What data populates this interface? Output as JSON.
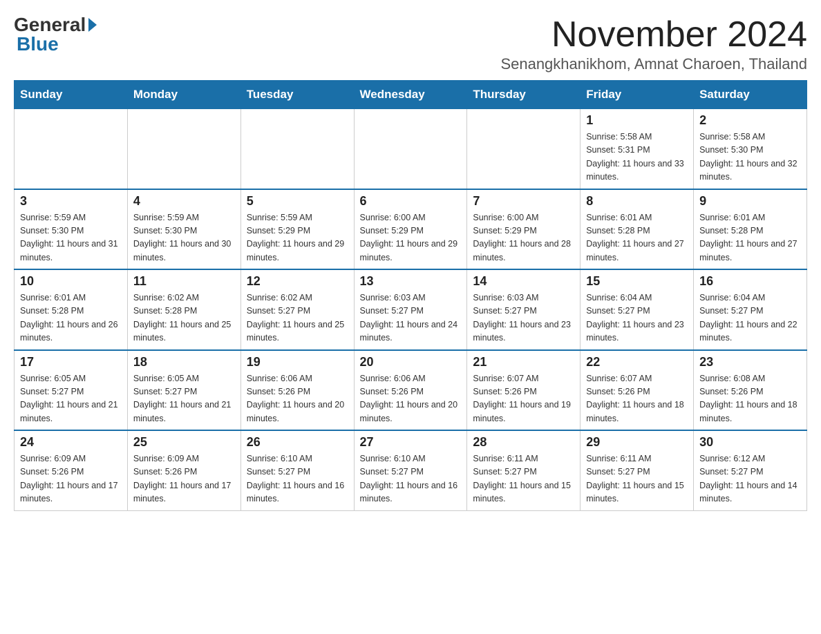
{
  "logo": {
    "general": "General",
    "blue": "Blue"
  },
  "title": "November 2024",
  "subtitle": "Senangkhanikhom, Amnat Charoen, Thailand",
  "days": [
    "Sunday",
    "Monday",
    "Tuesday",
    "Wednesday",
    "Thursday",
    "Friday",
    "Saturday"
  ],
  "weeks": [
    [
      {
        "day": "",
        "info": ""
      },
      {
        "day": "",
        "info": ""
      },
      {
        "day": "",
        "info": ""
      },
      {
        "day": "",
        "info": ""
      },
      {
        "day": "",
        "info": ""
      },
      {
        "day": "1",
        "info": "Sunrise: 5:58 AM\nSunset: 5:31 PM\nDaylight: 11 hours and 33 minutes."
      },
      {
        "day": "2",
        "info": "Sunrise: 5:58 AM\nSunset: 5:30 PM\nDaylight: 11 hours and 32 minutes."
      }
    ],
    [
      {
        "day": "3",
        "info": "Sunrise: 5:59 AM\nSunset: 5:30 PM\nDaylight: 11 hours and 31 minutes."
      },
      {
        "day": "4",
        "info": "Sunrise: 5:59 AM\nSunset: 5:30 PM\nDaylight: 11 hours and 30 minutes."
      },
      {
        "day": "5",
        "info": "Sunrise: 5:59 AM\nSunset: 5:29 PM\nDaylight: 11 hours and 29 minutes."
      },
      {
        "day": "6",
        "info": "Sunrise: 6:00 AM\nSunset: 5:29 PM\nDaylight: 11 hours and 29 minutes."
      },
      {
        "day": "7",
        "info": "Sunrise: 6:00 AM\nSunset: 5:29 PM\nDaylight: 11 hours and 28 minutes."
      },
      {
        "day": "8",
        "info": "Sunrise: 6:01 AM\nSunset: 5:28 PM\nDaylight: 11 hours and 27 minutes."
      },
      {
        "day": "9",
        "info": "Sunrise: 6:01 AM\nSunset: 5:28 PM\nDaylight: 11 hours and 27 minutes."
      }
    ],
    [
      {
        "day": "10",
        "info": "Sunrise: 6:01 AM\nSunset: 5:28 PM\nDaylight: 11 hours and 26 minutes."
      },
      {
        "day": "11",
        "info": "Sunrise: 6:02 AM\nSunset: 5:28 PM\nDaylight: 11 hours and 25 minutes."
      },
      {
        "day": "12",
        "info": "Sunrise: 6:02 AM\nSunset: 5:27 PM\nDaylight: 11 hours and 25 minutes."
      },
      {
        "day": "13",
        "info": "Sunrise: 6:03 AM\nSunset: 5:27 PM\nDaylight: 11 hours and 24 minutes."
      },
      {
        "day": "14",
        "info": "Sunrise: 6:03 AM\nSunset: 5:27 PM\nDaylight: 11 hours and 23 minutes."
      },
      {
        "day": "15",
        "info": "Sunrise: 6:04 AM\nSunset: 5:27 PM\nDaylight: 11 hours and 23 minutes."
      },
      {
        "day": "16",
        "info": "Sunrise: 6:04 AM\nSunset: 5:27 PM\nDaylight: 11 hours and 22 minutes."
      }
    ],
    [
      {
        "day": "17",
        "info": "Sunrise: 6:05 AM\nSunset: 5:27 PM\nDaylight: 11 hours and 21 minutes."
      },
      {
        "day": "18",
        "info": "Sunrise: 6:05 AM\nSunset: 5:27 PM\nDaylight: 11 hours and 21 minutes."
      },
      {
        "day": "19",
        "info": "Sunrise: 6:06 AM\nSunset: 5:26 PM\nDaylight: 11 hours and 20 minutes."
      },
      {
        "day": "20",
        "info": "Sunrise: 6:06 AM\nSunset: 5:26 PM\nDaylight: 11 hours and 20 minutes."
      },
      {
        "day": "21",
        "info": "Sunrise: 6:07 AM\nSunset: 5:26 PM\nDaylight: 11 hours and 19 minutes."
      },
      {
        "day": "22",
        "info": "Sunrise: 6:07 AM\nSunset: 5:26 PM\nDaylight: 11 hours and 18 minutes."
      },
      {
        "day": "23",
        "info": "Sunrise: 6:08 AM\nSunset: 5:26 PM\nDaylight: 11 hours and 18 minutes."
      }
    ],
    [
      {
        "day": "24",
        "info": "Sunrise: 6:09 AM\nSunset: 5:26 PM\nDaylight: 11 hours and 17 minutes."
      },
      {
        "day": "25",
        "info": "Sunrise: 6:09 AM\nSunset: 5:26 PM\nDaylight: 11 hours and 17 minutes."
      },
      {
        "day": "26",
        "info": "Sunrise: 6:10 AM\nSunset: 5:27 PM\nDaylight: 11 hours and 16 minutes."
      },
      {
        "day": "27",
        "info": "Sunrise: 6:10 AM\nSunset: 5:27 PM\nDaylight: 11 hours and 16 minutes."
      },
      {
        "day": "28",
        "info": "Sunrise: 6:11 AM\nSunset: 5:27 PM\nDaylight: 11 hours and 15 minutes."
      },
      {
        "day": "29",
        "info": "Sunrise: 6:11 AM\nSunset: 5:27 PM\nDaylight: 11 hours and 15 minutes."
      },
      {
        "day": "30",
        "info": "Sunrise: 6:12 AM\nSunset: 5:27 PM\nDaylight: 11 hours and 14 minutes."
      }
    ]
  ]
}
